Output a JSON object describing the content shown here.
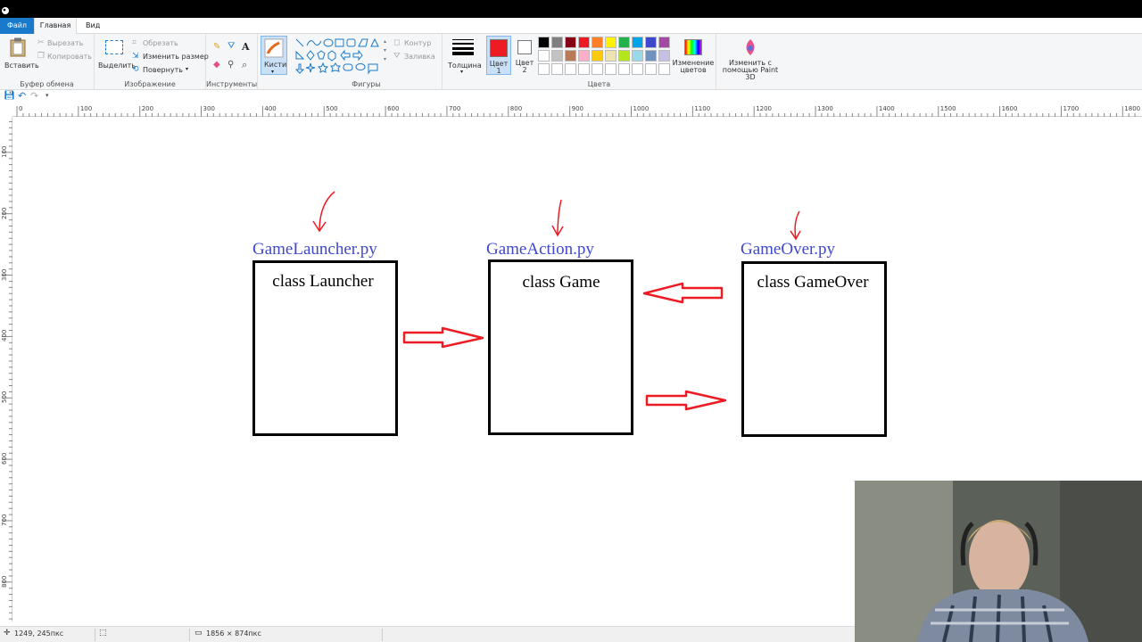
{
  "tabs": [
    "Файл",
    "Главная",
    "Вид"
  ],
  "ribbon": {
    "clipboard": {
      "paste": "Вставить",
      "cut": "Вырезать",
      "copy": "Копировать",
      "label": "Буфер обмена"
    },
    "image": {
      "select": "Выделить",
      "crop": "Обрезать",
      "resize": "Изменить размер",
      "rotate": "Повернуть",
      "label": "Изображение"
    },
    "tools": {
      "label": "Инструменты"
    },
    "brushes": {
      "label": "Кисти"
    },
    "shapes": {
      "outline": "Контур",
      "fill": "Заливка",
      "label": "Фигуры"
    },
    "size": {
      "label": "Толщина"
    },
    "colors": {
      "color1": "Цвет 1",
      "color2": "Цвет 2",
      "edit": "Изменение цветов",
      "label": "Цвета",
      "color1_value": "#ed1c24",
      "color2_value": "#ffffff",
      "palette_row1": [
        "#000000",
        "#7f7f7f",
        "#880015",
        "#ed1c24",
        "#ff7f27",
        "#fff200",
        "#22b14c",
        "#00a2e8",
        "#3f48cc",
        "#a349a4"
      ],
      "palette_row2": [
        "#ffffff",
        "#c3c3c3",
        "#b97a57",
        "#ffaec9",
        "#ffc90e",
        "#efe4b0",
        "#b5e61d",
        "#99d9ea",
        "#7092be",
        "#c8bfe7"
      ]
    },
    "paint3d": {
      "label": "Изменить с помощью Paint 3D"
    }
  },
  "ruler": {
    "h_ticks": [
      "0",
      "100",
      "200",
      "300",
      "400",
      "500",
      "600",
      "700",
      "800",
      "900",
      "1000",
      "1100",
      "1200",
      "1300",
      "1400",
      "1500",
      "1600",
      "1700",
      "1800"
    ],
    "v_ticks": [
      "100",
      "200",
      "300",
      "400",
      "500",
      "600",
      "700",
      "800"
    ]
  },
  "drawing": {
    "files": [
      "GameLauncher.py",
      "GameAction.py",
      "GameOver.py"
    ],
    "classes": [
      "class Launcher",
      "class Game",
      "class GameOver"
    ],
    "file_color": "#3f48cc",
    "arrow_color": "#ed1c24"
  },
  "status": {
    "cursor": "1249, 245пкс",
    "dimensions": "1856 × 874пкс"
  }
}
